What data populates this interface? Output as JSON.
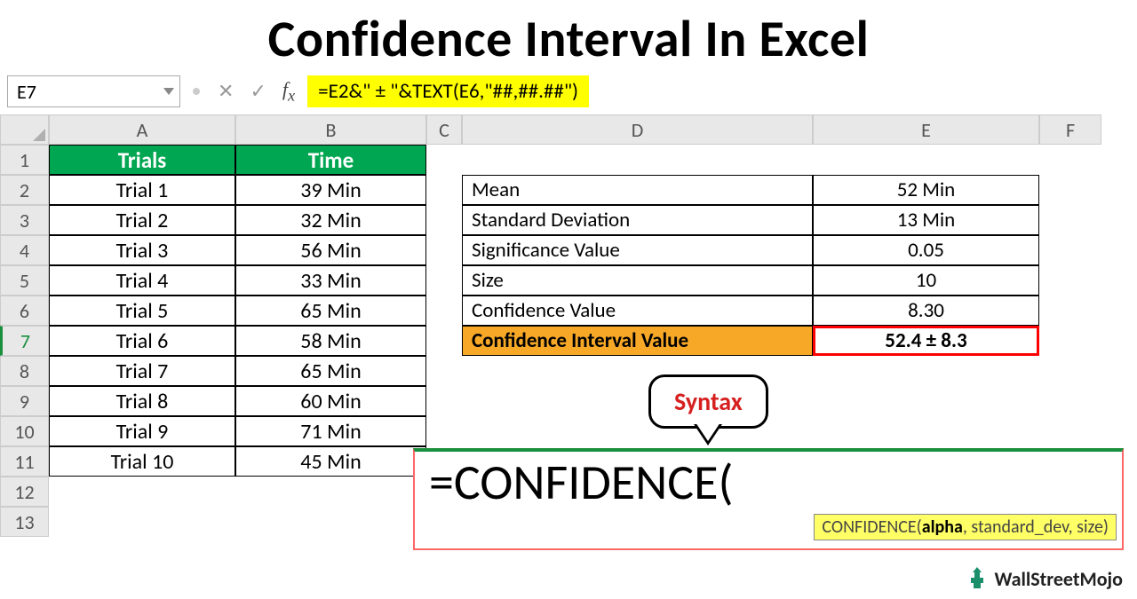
{
  "title": "Confidence Interval In Excel",
  "nameBox": "E7",
  "formula": "=E2&\" ± \"&TEXT(E6,\"##,##.##\")",
  "columns": [
    "A",
    "B",
    "C",
    "D",
    "E",
    "F"
  ],
  "rows": [
    "1",
    "2",
    "3",
    "4",
    "5",
    "6",
    "7",
    "8",
    "9",
    "10",
    "11",
    "12",
    "13"
  ],
  "trialHeader": {
    "a": "Trials",
    "b": "Time"
  },
  "trials": [
    {
      "a": "Trial 1",
      "b": "39 Min"
    },
    {
      "a": "Trial 2",
      "b": "32 Min"
    },
    {
      "a": "Trial 3",
      "b": "56 Min"
    },
    {
      "a": "Trial 4",
      "b": "33 Min"
    },
    {
      "a": "Trial 5",
      "b": "65 Min"
    },
    {
      "a": "Trial 6",
      "b": "58 Min"
    },
    {
      "a": "Trial 7",
      "b": "65 Min"
    },
    {
      "a": "Trial 8",
      "b": "60 Min"
    },
    {
      "a": "Trial 9",
      "b": "71 Min"
    },
    {
      "a": "Trial 10",
      "b": "45 Min"
    }
  ],
  "stats": [
    {
      "label": "Mean",
      "value": "52 Min"
    },
    {
      "label": "Standard Deviation",
      "value": "13 Min"
    },
    {
      "label": "Significance Value",
      "value": "0.05"
    },
    {
      "label": "Size",
      "value": "10"
    },
    {
      "label": "Confidence Value",
      "value": "8.30"
    },
    {
      "label": "Confidence Interval Value",
      "value": "52.4 ± 8.3"
    }
  ],
  "syntax": "Syntax",
  "bigFormula": "=CONFIDENCE(",
  "tooltip": {
    "fn": "CONFIDENCE(",
    "p1": "alpha",
    "rest": ", standard_dev, size)"
  },
  "brand": "WallStreetMojo"
}
